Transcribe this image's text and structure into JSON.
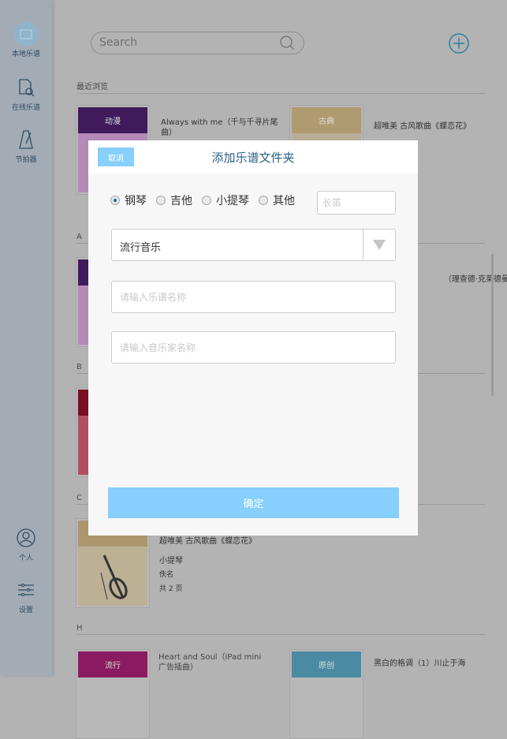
{
  "sidebar": {
    "items": [
      {
        "label": "本地乐谱",
        "icon": "folder-icon",
        "active": true
      },
      {
        "label": "在线乐谱",
        "icon": "search-document-icon"
      },
      {
        "label": "节拍器",
        "icon": "metronome-icon"
      },
      {
        "label": "个人",
        "icon": "user-icon"
      },
      {
        "label": "设置",
        "icon": "sliders-icon"
      }
    ]
  },
  "search": {
    "placeholder": "Search"
  },
  "sections": {
    "recent": "最近浏览",
    "a": "A",
    "b": "B",
    "c": "C",
    "h": "H"
  },
  "cards": {
    "recent1": {
      "tag": "动漫",
      "title": "Always with me（千与千寻片尾曲）",
      "colors": [
        "#3f1b5c",
        "#b48ab8"
      ]
    },
    "recent2": {
      "tag": "古典",
      "title": "超唯美 古风歌曲《蝶恋花》",
      "colors": [
        "#b09a70",
        "#b8ad98"
      ]
    },
    "a2": {
      "title": "理查德·克莱德曼）"
    },
    "c1": {
      "title": "超唯美 古风歌曲《蝶恋花》",
      "instrument": "小提琴",
      "composer": "佚名",
      "pages": "共 2 页"
    },
    "h1": {
      "tag": "流行",
      "title": "Heart and Soul（iPad mini 广告插曲）",
      "color": "#8a1a62"
    },
    "h2": {
      "tag": "原创",
      "title": "黑白的格调（1）川止于海",
      "color": "#4a8aa3"
    }
  },
  "dialog": {
    "title": "添加乐谱文件夹",
    "cancel": "取消",
    "instruments": [
      {
        "label": "钢琴",
        "checked": true
      },
      {
        "label": "吉他",
        "checked": false
      },
      {
        "label": "小提琴",
        "checked": false
      },
      {
        "label": "其他",
        "checked": false
      }
    ],
    "other_placeholder": "长笛",
    "category": "流行音乐",
    "name_placeholder": "请输入乐谱名称",
    "composer_placeholder": "请输入音乐家名称",
    "confirm": "确定"
  },
  "colors": {
    "accent": "#87cffc",
    "title": "#2a5f86"
  }
}
